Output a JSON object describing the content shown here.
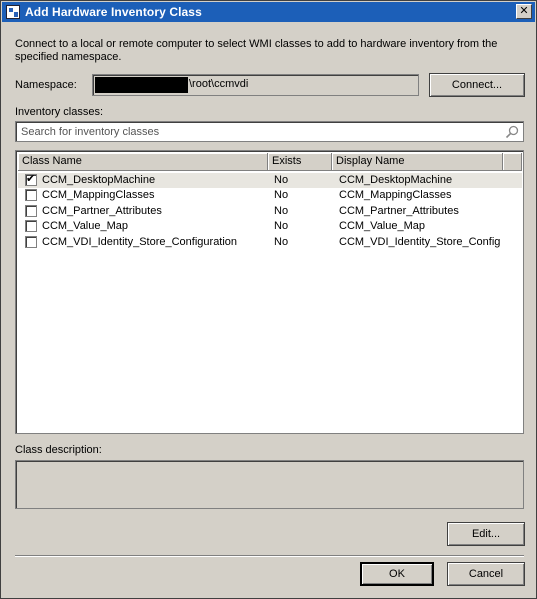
{
  "window": {
    "title": "Add Hardware Inventory Class",
    "close_glyph": "✕"
  },
  "intro": "Connect to a local or remote computer to select WMI classes to add to hardware inventory from the specified namespace.",
  "namespace": {
    "label": "Namespace:",
    "value": "\\root\\ccmvdi",
    "connect_label": "Connect..."
  },
  "inventory": {
    "label": "Inventory classes:",
    "search_placeholder": "Search for inventory classes",
    "columns": [
      "Class Name",
      "Exists",
      "Display Name"
    ],
    "rows": [
      {
        "checked": true,
        "class_name": "CCM_DesktopMachine",
        "exists": "No",
        "display_name": "CCM_DesktopMachine"
      },
      {
        "checked": false,
        "class_name": "CCM_MappingClasses",
        "exists": "No",
        "display_name": "CCM_MappingClasses"
      },
      {
        "checked": false,
        "class_name": "CCM_Partner_Attributes",
        "exists": "No",
        "display_name": "CCM_Partner_Attributes"
      },
      {
        "checked": false,
        "class_name": "CCM_Value_Map",
        "exists": "No",
        "display_name": "CCM_Value_Map"
      },
      {
        "checked": false,
        "class_name": "CCM_VDI_Identity_Store_Configuration",
        "exists": "No",
        "display_name": "CCM_VDI_Identity_Store_Config"
      }
    ]
  },
  "description": {
    "label": "Class description:",
    "value": ""
  },
  "buttons": {
    "edit": "Edit...",
    "ok": "OK",
    "cancel": "Cancel"
  },
  "icons": {
    "app": "app-icon",
    "search": "search-icon",
    "check": "checkmark-icon"
  }
}
